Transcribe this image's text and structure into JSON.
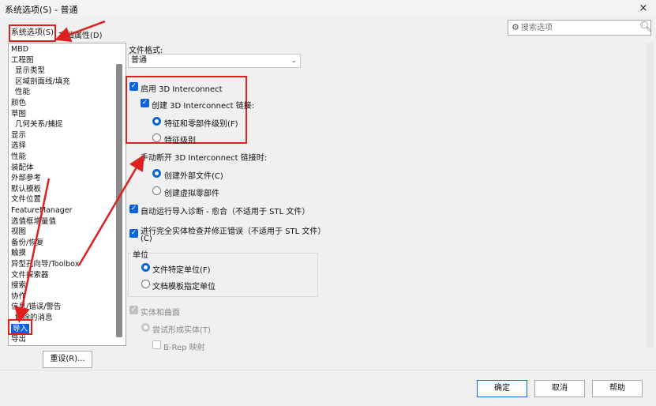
{
  "window": {
    "title": "系统选项(S) - 普通",
    "close_glyph": "×"
  },
  "tabs": {
    "system": "系统选项(S)",
    "document": "文档属性(D)"
  },
  "search": {
    "placeholder": "搜索选项"
  },
  "tree": {
    "items": [
      {
        "label": "MBD",
        "sub": false
      },
      {
        "label": "工程图",
        "sub": false
      },
      {
        "label": "显示类型",
        "sub": true
      },
      {
        "label": "区域剖面线/填充",
        "sub": true
      },
      {
        "label": "性能",
        "sub": true
      },
      {
        "label": "颜色",
        "sub": false
      },
      {
        "label": "草图",
        "sub": false
      },
      {
        "label": "几何关系/捕捉",
        "sub": true
      },
      {
        "label": "显示",
        "sub": false
      },
      {
        "label": "选择",
        "sub": false
      },
      {
        "label": "性能",
        "sub": false
      },
      {
        "label": "装配体",
        "sub": false
      },
      {
        "label": "外部参考",
        "sub": false
      },
      {
        "label": "默认模板",
        "sub": false
      },
      {
        "label": "文件位置",
        "sub": false
      },
      {
        "label": "FeatureManager",
        "sub": false
      },
      {
        "label": "选值框增量值",
        "sub": false
      },
      {
        "label": "视图",
        "sub": false
      },
      {
        "label": "备份/恢复",
        "sub": false
      },
      {
        "label": "触摸",
        "sub": false
      },
      {
        "label": "异型孔向导/Toolbox",
        "sub": false
      },
      {
        "label": "文件探索器",
        "sub": false
      },
      {
        "label": "搜索",
        "sub": false
      },
      {
        "label": "协作",
        "sub": false
      },
      {
        "label": "信息/错误/警告",
        "sub": false
      },
      {
        "label": "解除的消息",
        "sub": true
      },
      {
        "label": "导入",
        "sub": false,
        "selected": true
      },
      {
        "label": "导出",
        "sub": false
      }
    ]
  },
  "reset_button": "重设(R)...",
  "file_format": {
    "label": "文件格式:",
    "value": "普通",
    "chevron": "⌄"
  },
  "options": {
    "enable_3di": "启用 3D Interconnect",
    "create_link": "创建 3D Interconnect 链接:",
    "feature_part_level": "特征和零部件级别(F)",
    "feature_level": "特征级别",
    "manual_break": "手动断开 3D Interconnect 链接时:",
    "create_external": "创建外部文件(C)",
    "create_virtual": "创建虚拟零部件",
    "auto_diag": "自动运行导入诊断 - 愈合（不适用于 STL 文件）",
    "full_check": "进行完全实体检查并修正错误（不适用于 STL 文件）",
    "full_check_suffix": "(C)",
    "units_label": "单位",
    "units_file": "文件特定单位(F)",
    "units_template": "文档模板指定单位",
    "solid_surface": "实体和曲面",
    "try_solid": "尝试形成实体(T)",
    "brep": "B-Rep 映射"
  },
  "check_glyph": "✓",
  "footer": {
    "ok": "确定",
    "cancel": "取消",
    "help": "帮助"
  },
  "colors": {
    "accent": "#0a64d8",
    "highlight": "#e02020"
  }
}
